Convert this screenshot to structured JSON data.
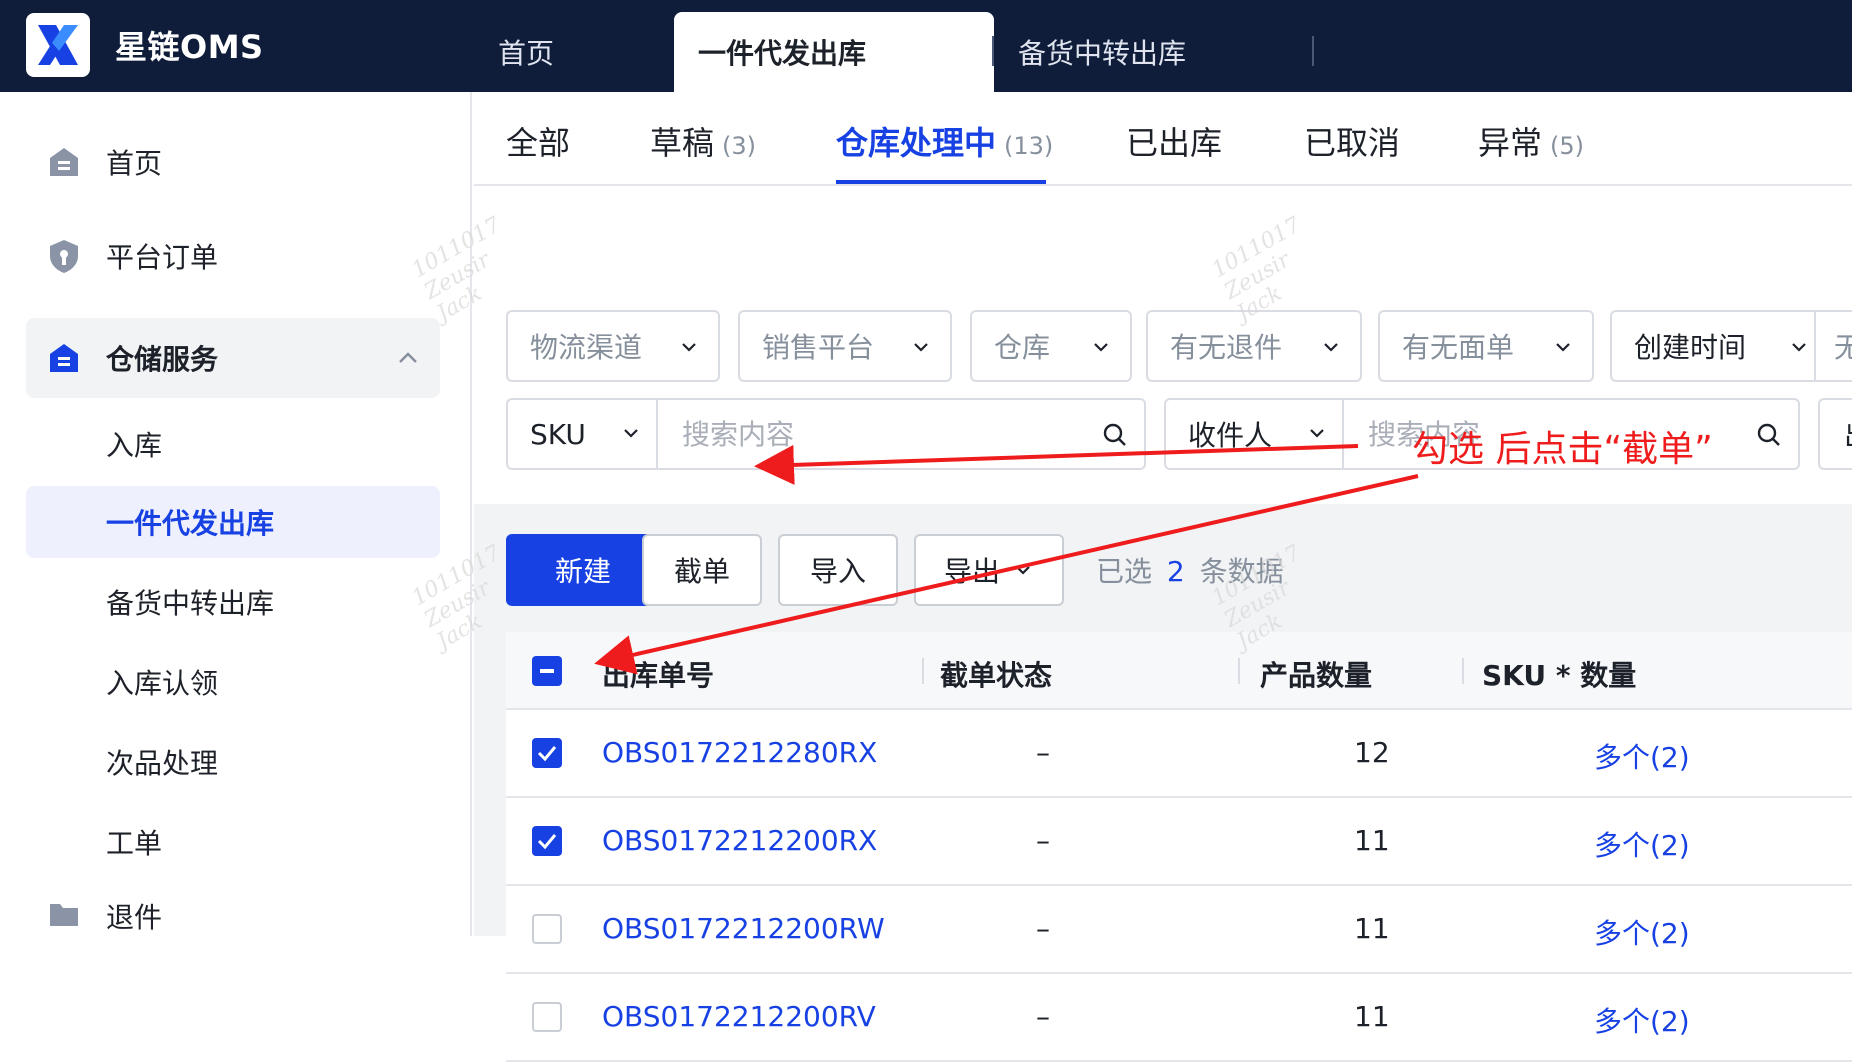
{
  "app": {
    "title": "星链OMS"
  },
  "top_tabs": [
    {
      "label": "首页"
    },
    {
      "label": "一件代发出库"
    },
    {
      "label": "备货中转出库"
    }
  ],
  "sidebar": {
    "items": [
      {
        "label": "首页",
        "icon": "home-icon"
      },
      {
        "label": "平台订单",
        "icon": "shield-icon"
      },
      {
        "label": "仓储服务",
        "icon": "warehouse-icon"
      }
    ],
    "sub_items": [
      {
        "label": "入库"
      },
      {
        "label": "一件代发出库"
      },
      {
        "label": "备货中转出库"
      },
      {
        "label": "入库认领"
      },
      {
        "label": "次品处理"
      },
      {
        "label": "工单"
      },
      {
        "label": "退件"
      }
    ]
  },
  "status_tabs": [
    {
      "label": "全部",
      "count": ""
    },
    {
      "label": "草稿",
      "count": "(3)"
    },
    {
      "label": "仓库处理中",
      "count": "(13)"
    },
    {
      "label": "已出库",
      "count": ""
    },
    {
      "label": "已取消",
      "count": ""
    },
    {
      "label": "异常",
      "count": "(5)"
    }
  ],
  "filters": {
    "selects": [
      "物流渠道",
      "销售平台",
      "仓库",
      "有无退件",
      "有无面单",
      "创建时间",
      "无"
    ],
    "search1": {
      "field": "SKU",
      "placeholder": "搜索内容"
    },
    "search2": {
      "field": "收件人",
      "placeholder": "搜索内容"
    },
    "extra": "出"
  },
  "toolbar": {
    "new_label": "新建",
    "intercept_label": "截单",
    "import_label": "导入",
    "export_label": "导出",
    "selected_prefix": "已选",
    "selected_count": "2",
    "selected_suffix": "条数据"
  },
  "table": {
    "headers": [
      "出库单号",
      "截单状态",
      "产品数量",
      "SKU * 数量"
    ],
    "rows": [
      {
        "order": "OBS0172212280RX",
        "status": "–",
        "qty": "12",
        "sku": "多个(2)",
        "checked": true
      },
      {
        "order": "OBS0172212200RX",
        "status": "–",
        "qty": "11",
        "sku": "多个(2)",
        "checked": true
      },
      {
        "order": "OBS0172212200RW",
        "status": "–",
        "qty": "11",
        "sku": "多个(2)",
        "checked": false
      },
      {
        "order": "OBS0172212200RV",
        "status": "–",
        "qty": "11",
        "sku": "多个(2)",
        "checked": false
      }
    ]
  },
  "annotation": {
    "text": "勾选 后点击“截单”",
    "color": "#ee1c1c"
  },
  "watermark": {
    "lines": [
      "1011017",
      "Zeusir",
      "Jack"
    ]
  },
  "colors": {
    "primary": "#1741e3",
    "topbar": "#0f1d3a",
    "annotation": "#ee1c1c"
  }
}
